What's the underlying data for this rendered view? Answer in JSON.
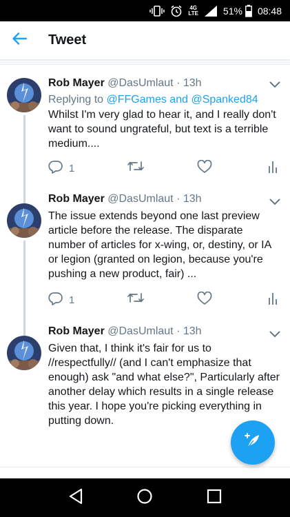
{
  "status_bar": {
    "network": "4G",
    "lte": "LTE",
    "battery": "51%",
    "time": "08:48"
  },
  "app_bar": {
    "title": "Tweet"
  },
  "tweets": [
    {
      "name": "Rob Mayer",
      "handle": "@DasUmlaut",
      "time": "13h",
      "replying_prefix": "Replying to",
      "replying_to": "@FFGames and @Spanked84",
      "text": "Whilst I'm very glad to hear it, and I really don't want to sound ungrateful, but text is a terrible medium....",
      "reply_count": "1"
    },
    {
      "name": "Rob Mayer",
      "handle": "@DasUmlaut",
      "time": "13h",
      "text": "The issue extends beyond one last preview article before the release. The disparate number of articles for x-wing, or, destiny, or IA or legion (granted on legion, because you're pushing a new product, fair) ...",
      "reply_count": "1"
    },
    {
      "name": "Rob Mayer",
      "handle": "@DasUmlaut",
      "time": "13h",
      "text": "Given that, I think it's fair for us to //respectfully// (and I can't emphasize that enough) ask \"and what else?\", Particularly after another delay which results in a single release this year. I hope you're picking everything in putting down.",
      "reply_count": ""
    }
  ],
  "colors": {
    "accent": "#1da1f2",
    "text": "#14171a",
    "secondary": "#657786",
    "divider": "#e6ecf0"
  },
  "icons": [
    "vibrate-icon",
    "alarm-icon",
    "signal-icon",
    "battery-icon",
    "back-arrow-icon",
    "caret-down-icon",
    "reply-icon",
    "retweet-icon",
    "like-icon",
    "analytics-icon",
    "compose-icon",
    "nav-back-icon",
    "nav-home-icon",
    "nav-recents-icon"
  ]
}
